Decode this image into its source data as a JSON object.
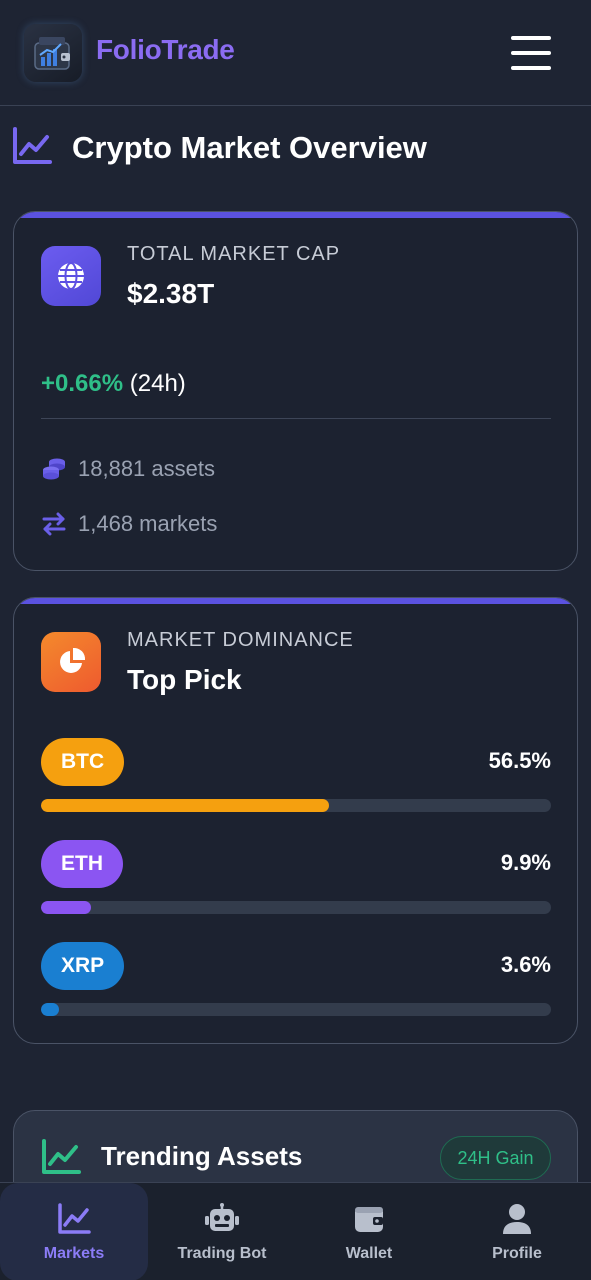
{
  "header": {
    "brand": "FolioTrade",
    "logo_icon": "wallet-chart-icon",
    "menu_icon": "hamburger-menu-icon"
  },
  "page": {
    "title": "Crypto Market Overview",
    "title_icon": "line-chart-icon"
  },
  "market_cap_card": {
    "icon": "globe-icon",
    "label": "TOTAL MARKET CAP",
    "value": "$2.38T",
    "change": "+0.66%",
    "change_period": "(24h)",
    "assets": "18,881 assets",
    "assets_icon": "coins-icon",
    "markets": "1,468 markets",
    "markets_icon": "exchange-arrows-icon"
  },
  "dominance_card": {
    "icon": "pie-chart-icon",
    "label": "MARKET DOMINANCE",
    "value": "Top Pick",
    "items": [
      {
        "symbol": "BTC",
        "percent_label": "56.5%",
        "percent": 56.5,
        "color": "#f5a00f"
      },
      {
        "symbol": "ETH",
        "percent_label": "9.9%",
        "percent": 9.9,
        "color": "#8b55f2"
      },
      {
        "symbol": "XRP",
        "percent_label": "3.6%",
        "percent": 3.6,
        "color": "#1a7fd1"
      }
    ]
  },
  "trending_card": {
    "icon": "line-chart-icon",
    "title": "Trending Assets",
    "badge": "24H Gain"
  },
  "bottom_nav": {
    "items": [
      {
        "label": "Markets",
        "icon": "chart-icon",
        "active": true
      },
      {
        "label": "Trading Bot",
        "icon": "robot-icon",
        "active": false
      },
      {
        "label": "Wallet",
        "icon": "wallet-icon",
        "active": false
      },
      {
        "label": "Profile",
        "icon": "user-icon",
        "active": false
      }
    ]
  },
  "colors": {
    "background": "#1e2433",
    "accent": "#8b6cf2",
    "positive": "#2fbf88"
  }
}
